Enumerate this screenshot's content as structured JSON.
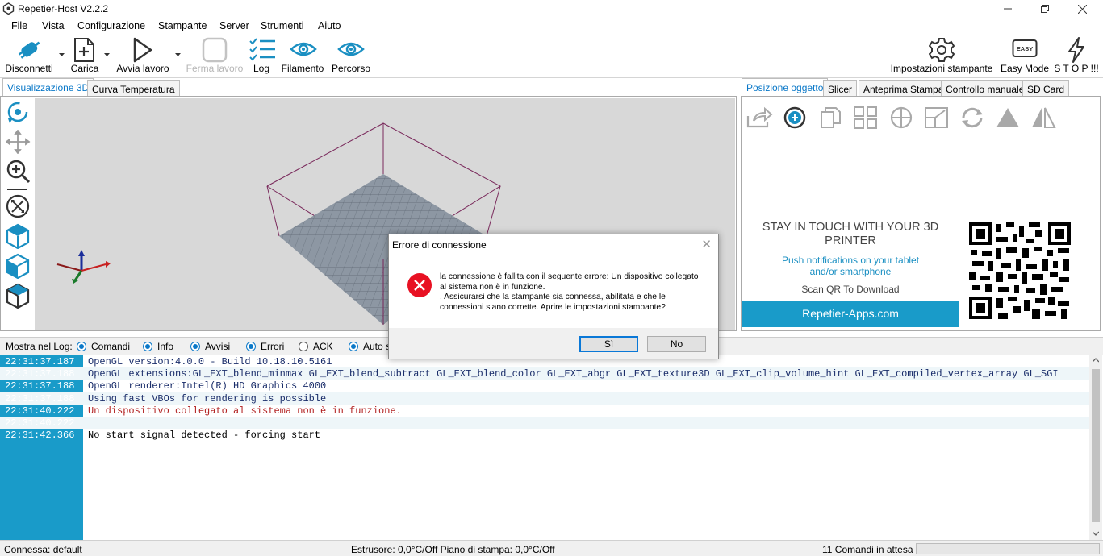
{
  "window": {
    "title": "Repetier-Host V2.2.2"
  },
  "menu": [
    "File",
    "Vista",
    "Configurazione",
    "Stampante",
    "Server",
    "Strumenti",
    "Aiuto"
  ],
  "toolbar": {
    "disconnect": "Disconnetti",
    "load": "Carica",
    "start": "Avvia lavoro",
    "stop_job": "Ferma lavoro",
    "log": "Log",
    "filament": "Filamento",
    "path": "Percorso",
    "printer_settings": "Impostazioni stampante",
    "easy_mode": "Easy Mode",
    "easy_icon_text": "EASY",
    "stop": "S T O P !!!"
  },
  "left_tabs": [
    "Visualizzazione 3D",
    "Curva Temperatura"
  ],
  "right_tabs": [
    "Posizione oggetto",
    "Slicer",
    "Anteprima Stampa",
    "Controllo manuale",
    "SD Card"
  ],
  "promo": {
    "title": "STAY IN TOUCH WITH YOUR 3D PRINTER",
    "subtitle": "Push notifications on your tablet and/or smartphone",
    "scan": "Scan QR To Download",
    "button": "Repetier-Apps.com"
  },
  "log_filter": {
    "label": "Mostra nel Log:",
    "options": [
      {
        "label": "Comandi",
        "checked": true
      },
      {
        "label": "Info",
        "checked": true
      },
      {
        "label": "Avvisi",
        "checked": true
      },
      {
        "label": "Errori",
        "checked": true
      },
      {
        "label": "ACK",
        "checked": false
      },
      {
        "label": "Auto s",
        "checked": true
      }
    ]
  },
  "log": [
    {
      "time": "22:31:37.187",
      "msg": "OpenGL version:4.0.0 - Build 10.18.10.5161",
      "level": "info"
    },
    {
      "time": "22:31:37.188",
      "msg": "OpenGL extensions:GL_EXT_blend_minmax GL_EXT_blend_subtract GL_EXT_blend_color GL_EXT_abgr GL_EXT_texture3D GL_EXT_clip_volume_hint GL_EXT_compiled_vertex_array GL_SGI",
      "level": "info"
    },
    {
      "time": "22:31:37.188",
      "msg": "OpenGL renderer:Intel(R) HD Graphics 4000",
      "level": "info"
    },
    {
      "time": "22:31:37.188",
      "msg": "Using fast VBOs for rendering is possible",
      "level": "info"
    },
    {
      "time": "22:31:40.222",
      "msg": "Un dispositivo collegato al sistema non è in funzione.",
      "level": "error"
    },
    {
      "time": "22:31:40.222",
      "msg": "",
      "level": "info"
    },
    {
      "time": "22:31:42.366",
      "msg": "No start signal detected - forcing start",
      "level": "plain"
    }
  ],
  "status": {
    "connection": "Connessa: default",
    "temps": "Estrusore: 0,0°C/Off Piano di stampa: 0,0°C/Off",
    "queue": "11 Comandi in attesa"
  },
  "dialog": {
    "title": "Errore di connessione",
    "message": "la connessione è fallita con il seguente errore: Un dispositivo collegato al sistema non è in funzione.\n. Assicurarsi che la stampante sia connessa, abilitata e che le connessioni siano corrette. Aprire le impostazioni stampante?",
    "yes": "Sì",
    "no": "No"
  },
  "colors": {
    "accent": "#0a78c8",
    "icon_blue": "#1a8fc2",
    "log_time_bg": "#199bc9",
    "error_red": "#e81123",
    "promo_button": "#199bc9"
  }
}
